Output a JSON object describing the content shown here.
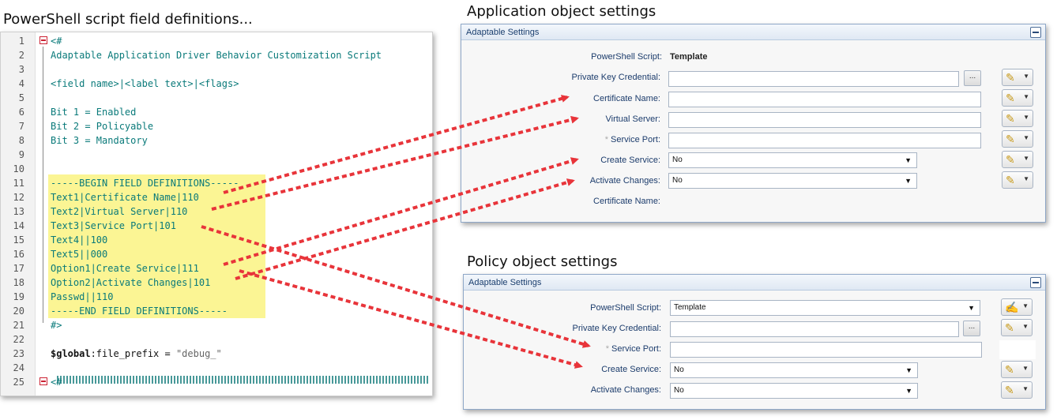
{
  "headings": {
    "script": "PowerShell script field definitions...",
    "application": "Application object settings",
    "policy": "Policy object settings"
  },
  "editor": {
    "lines": [
      {
        "n": "1",
        "text": "<#"
      },
      {
        "n": "2",
        "text": "Adaptable Application Driver Behavior Customization Script"
      },
      {
        "n": "3",
        "text": ""
      },
      {
        "n": "4",
        "text": "<field name>|<label text>|<flags>"
      },
      {
        "n": "5",
        "text": ""
      },
      {
        "n": "6",
        "text": "Bit 1 = Enabled"
      },
      {
        "n": "7",
        "text": "Bit 2 = Policyable"
      },
      {
        "n": "8",
        "text": "Bit 3 = Mandatory"
      },
      {
        "n": "9",
        "text": ""
      },
      {
        "n": "10",
        "text": ""
      },
      {
        "n": "11",
        "text": "-----BEGIN FIELD DEFINITIONS-----"
      },
      {
        "n": "12",
        "text": "Text1|Certificate Name|110"
      },
      {
        "n": "13",
        "text": "Text2|Virtual Server|110"
      },
      {
        "n": "14",
        "text": "Text3|Service Port|101"
      },
      {
        "n": "15",
        "text": "Text4||100"
      },
      {
        "n": "16",
        "text": "Text5||000"
      },
      {
        "n": "17",
        "text": "Option1|Create Service|111"
      },
      {
        "n": "18",
        "text": "Option2|Activate Changes|101"
      },
      {
        "n": "19",
        "text": "Passwd||110"
      },
      {
        "n": "20",
        "text": "-----END FIELD DEFINITIONS-----"
      },
      {
        "n": "21",
        "text": "#>"
      },
      {
        "n": "22",
        "text": ""
      },
      {
        "n": "23",
        "text": ""
      },
      {
        "n": "24",
        "text": ""
      },
      {
        "n": "25",
        "text": "<#"
      }
    ],
    "line23": {
      "var": "$global",
      "rest": ":file_prefix = ",
      "str": "\"debug_\""
    }
  },
  "app_panel": {
    "title": "Adaptable Settings",
    "powershell_label": "PowerShell Script:",
    "powershell_value": "Template",
    "private_key_label": "Private Key Credential:",
    "browse_label": "...",
    "cert_name_label": "Certificate Name:",
    "virtual_server_label": "Virtual Server:",
    "service_port_label": "Service Port:",
    "required_mark": "*",
    "create_service_label": "Create Service:",
    "create_service_value": "No",
    "activate_changes_label": "Activate Changes:",
    "activate_changes_value": "No",
    "cert_name_readonly_label": "Certificate Name:"
  },
  "policy_panel": {
    "title": "Adaptable Settings",
    "powershell_label": "PowerShell Script:",
    "powershell_value": "Template",
    "private_key_label": "Private Key Credential:",
    "browse_label": "...",
    "service_port_label": "Service Port:",
    "required_mark": "*",
    "create_service_label": "Create Service:",
    "create_service_value": "No",
    "activate_changes_label": "Activate Changes:",
    "activate_changes_value": "No"
  },
  "icons": {
    "flag_button": "pencil-icon",
    "policy_flag_button": "script-edit-icon",
    "dropdown": "chevron-down-icon",
    "collapse": "minus-icon"
  },
  "colors": {
    "arrow": "#e8343a",
    "highlight": "#fbf594",
    "code_text": "#0a7a7a",
    "label_text": "#1c3c6c"
  }
}
